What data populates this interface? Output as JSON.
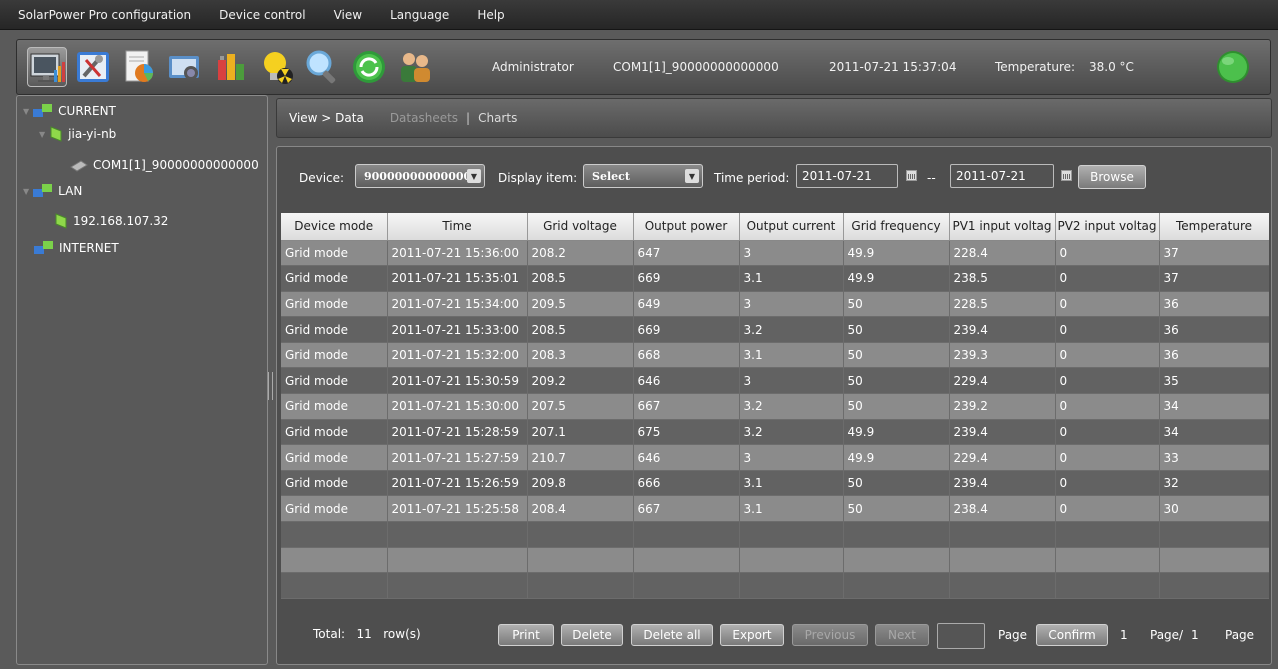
{
  "menu": [
    "SolarPower Pro configuration",
    "Device control",
    "View",
    "Language",
    "Help"
  ],
  "toolbar": {
    "user": "Administrator",
    "port": "COM1[1]_90000000000000",
    "datetime": "2011-07-21 15:37:04",
    "temperature_label": "Temperature:",
    "temperature_value": "38.0 °C",
    "icons": [
      "monitor-chart-icon",
      "tools-icon",
      "report-icon",
      "camera-icon",
      "battery-icon",
      "hazard-bulb-icon",
      "search-icon",
      "refresh-icon",
      "users-icon",
      "status-globe-icon"
    ]
  },
  "tree": {
    "current": "CURRENT",
    "host": "jia-yi-nb",
    "port": "COM1[1]_90000000000000",
    "lan": "LAN",
    "ip": "192.168.107.32",
    "internet": "INTERNET"
  },
  "breadcrumb": {
    "current": "View > Data",
    "datasheets": "Datasheets",
    "separator": "|",
    "charts": "Charts"
  },
  "filters": {
    "device_label": "Device:",
    "device_value": "90000000000000",
    "display_label": "Display item:",
    "display_value": "Select",
    "period_label": "Time period:",
    "date_from": "2011-07-21",
    "date_sep": "--",
    "date_to": "2011-07-21",
    "browse": "Browse"
  },
  "table": {
    "headers": [
      "Device mode",
      "Time",
      "Grid voltage",
      "Output power",
      "Output current",
      "Grid frequency",
      "PV1 input voltag",
      "PV2 input voltag",
      "Temperature"
    ],
    "rows": [
      [
        "Grid mode",
        "2011-07-21 15:36:00",
        "208.2",
        "647",
        "3",
        "49.9",
        "228.4",
        "0",
        "37"
      ],
      [
        "Grid mode",
        "2011-07-21 15:35:01",
        "208.5",
        "669",
        "3.1",
        "49.9",
        "238.5",
        "0",
        "37"
      ],
      [
        "Grid mode",
        "2011-07-21 15:34:00",
        "209.5",
        "649",
        "3",
        "50",
        "228.5",
        "0",
        "36"
      ],
      [
        "Grid mode",
        "2011-07-21 15:33:00",
        "208.5",
        "669",
        "3.2",
        "50",
        "239.4",
        "0",
        "36"
      ],
      [
        "Grid mode",
        "2011-07-21 15:32:00",
        "208.3",
        "668",
        "3.1",
        "50",
        "239.3",
        "0",
        "36"
      ],
      [
        "Grid mode",
        "2011-07-21 15:30:59",
        "209.2",
        "646",
        "3",
        "50",
        "229.4",
        "0",
        "35"
      ],
      [
        "Grid mode",
        "2011-07-21 15:30:00",
        "207.5",
        "667",
        "3.2",
        "50",
        "239.2",
        "0",
        "34"
      ],
      [
        "Grid mode",
        "2011-07-21 15:28:59",
        "207.1",
        "675",
        "3.2",
        "49.9",
        "239.4",
        "0",
        "34"
      ],
      [
        "Grid mode",
        "2011-07-21 15:27:59",
        "210.7",
        "646",
        "3",
        "49.9",
        "229.4",
        "0",
        "33"
      ],
      [
        "Grid mode",
        "2011-07-21 15:26:59",
        "209.8",
        "666",
        "3.1",
        "50",
        "239.4",
        "0",
        "32"
      ],
      [
        "Grid mode",
        "2011-07-21 15:25:58",
        "208.4",
        "667",
        "3.1",
        "50",
        "238.4",
        "0",
        "30"
      ]
    ]
  },
  "footer": {
    "total_label": "Total:",
    "total_value": "11",
    "rows_label": "row(s)",
    "print": "Print",
    "delete": "Delete",
    "delete_all": "Delete all",
    "export": "Export",
    "previous": "Previous",
    "next": "Next",
    "page_label": "Page",
    "confirm": "Confirm",
    "current_page": "1",
    "page_of_label": "Page/",
    "total_pages": "1",
    "page_suffix": "Page"
  }
}
